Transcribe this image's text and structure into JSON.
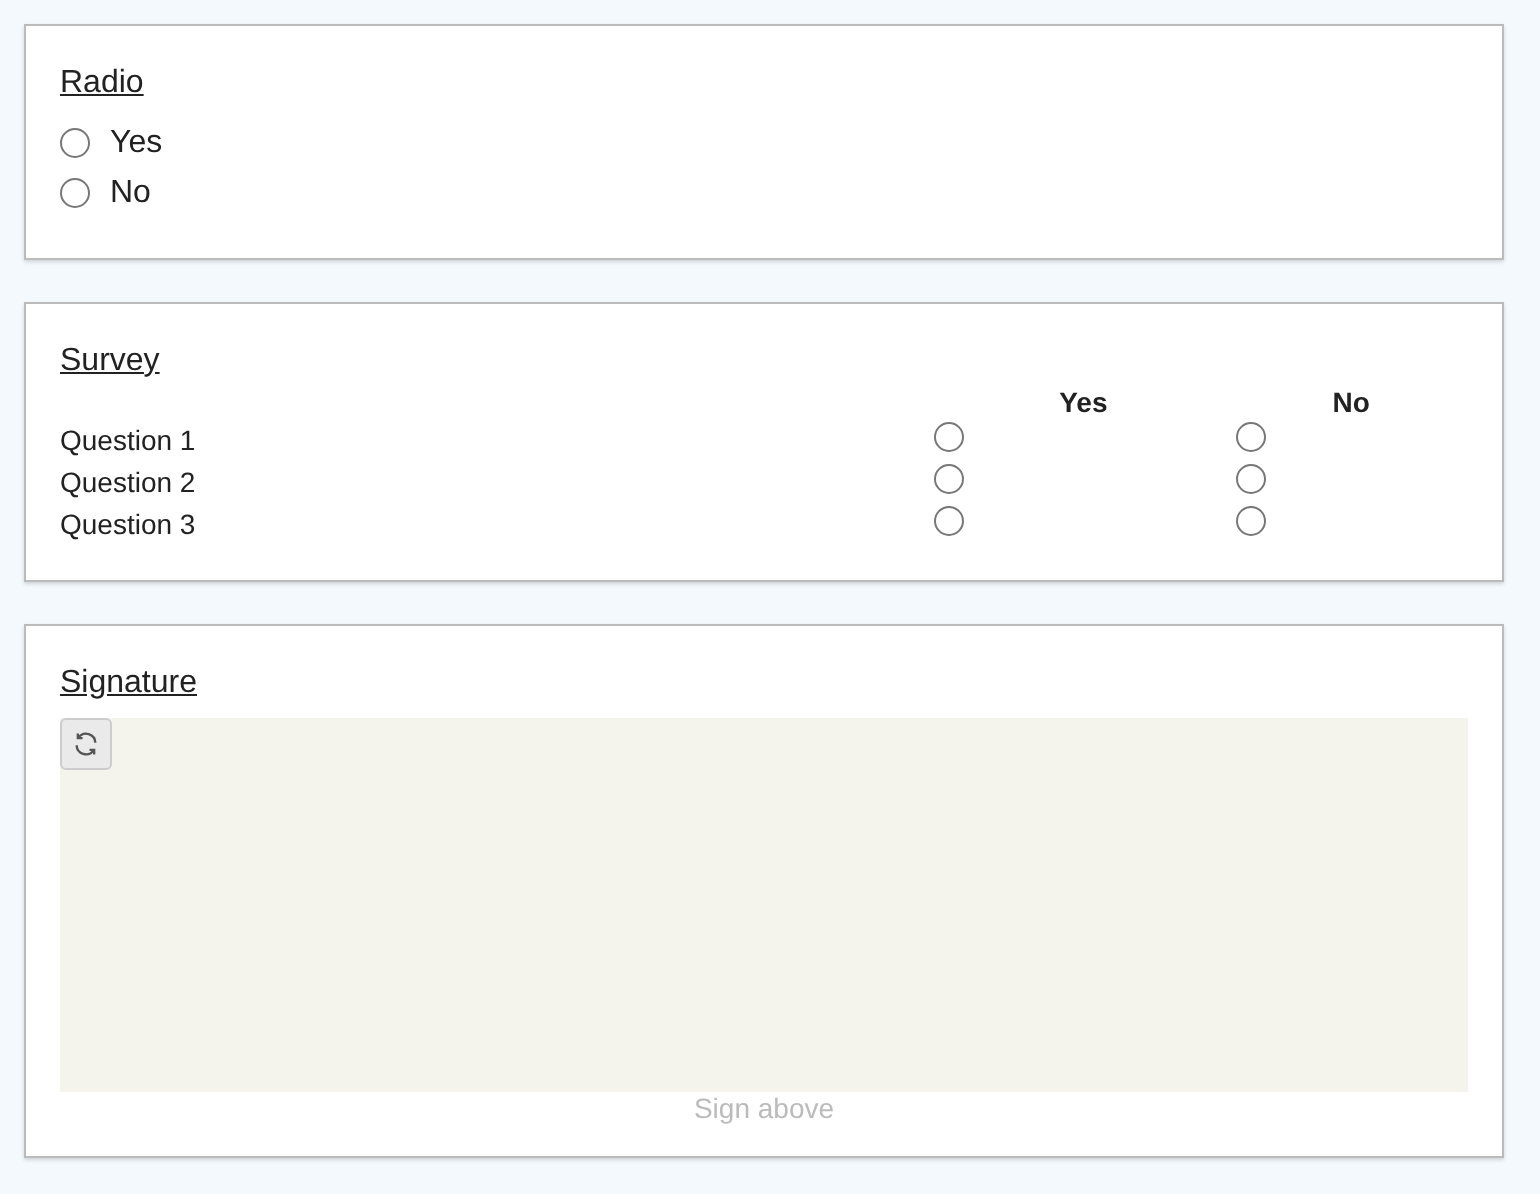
{
  "radio": {
    "title": "Radio",
    "options": [
      {
        "label": "Yes",
        "selected": false
      },
      {
        "label": "No",
        "selected": false
      }
    ]
  },
  "survey": {
    "title": "Survey",
    "columns": [
      "Yes",
      "No"
    ],
    "rows": [
      {
        "label": "Question 1",
        "choices": [
          {
            "selected": false
          },
          {
            "selected": false
          }
        ]
      },
      {
        "label": "Question 2",
        "choices": [
          {
            "selected": false
          },
          {
            "selected": false
          }
        ]
      },
      {
        "label": "Question 3",
        "choices": [
          {
            "selected": false
          },
          {
            "selected": false
          }
        ]
      }
    ]
  },
  "signature": {
    "title": "Signature",
    "hint": "Sign above"
  }
}
